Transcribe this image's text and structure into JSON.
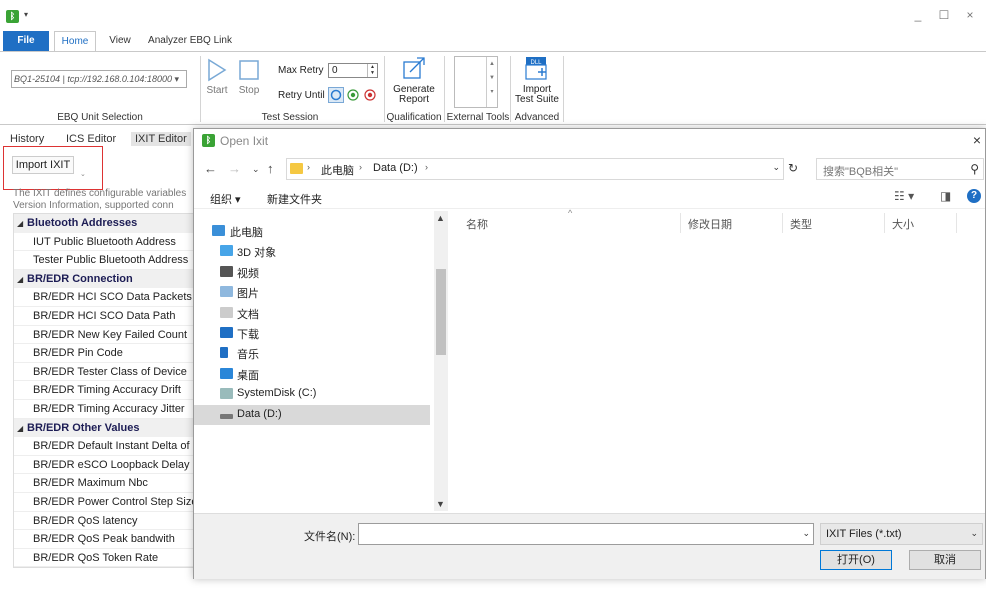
{
  "window": {
    "app_icon": "bluetooth-app-icon",
    "minimize": "_",
    "maximize": "☐",
    "close": "×"
  },
  "ribbon_tabs": [
    "File",
    "Home",
    "View",
    "Analyzer EBQ Link"
  ],
  "ribbon": {
    "ebq_combo_value": "BQ1-25104 | tcp://192.168.0.104:18000",
    "ebq_group_label": "EBQ Unit Selection",
    "start_label": "Start",
    "stop_label": "Stop",
    "max_retry_label": "Max Retry",
    "max_retry_value": "0",
    "retry_until_label": "Retry Until",
    "test_session_label": "Test Session",
    "generate_report_label_1": "Generate",
    "generate_report_label_2": "Report",
    "qualification_label": "Qualification",
    "external_tools_label": "External Tools",
    "import_test_suite_label_1": "Import",
    "import_test_suite_label_2": "Test Suite",
    "advanced_label": "Advanced"
  },
  "left": {
    "tabs": [
      "History",
      "ICS Editor",
      "IXIT Editor"
    ],
    "import_button": "Import IXIT",
    "description_1": "The IXIT defines configurable variables",
    "description_2": "Version Information, supported conn",
    "tree": [
      {
        "type": "header",
        "label": "Bluetooth Addresses"
      },
      {
        "type": "item",
        "label": "IUT Public Bluetooth Address"
      },
      {
        "type": "item",
        "label": "Tester Public Bluetooth Address"
      },
      {
        "type": "header",
        "label": "BR/EDR Connection"
      },
      {
        "type": "item",
        "label": "BR/EDR HCI SCO Data Packets Ne"
      },
      {
        "type": "item",
        "label": "BR/EDR HCI SCO Data Path"
      },
      {
        "type": "item",
        "label": "BR/EDR New Key Failed Count"
      },
      {
        "type": "item",
        "label": "BR/EDR Pin Code"
      },
      {
        "type": "item",
        "label": "BR/EDR Tester Class of Device"
      },
      {
        "type": "item",
        "label": "BR/EDR Timing Accuracy Drift"
      },
      {
        "type": "item",
        "label": "BR/EDR Timing Accuracy Jitter"
      },
      {
        "type": "header",
        "label": "BR/EDR Other Values"
      },
      {
        "type": "item",
        "label": "BR/EDR Default Instant Delta of P"
      },
      {
        "type": "item",
        "label": "BR/EDR eSCO Loopback Delay"
      },
      {
        "type": "item",
        "label": "BR/EDR Maximum Nbc"
      },
      {
        "type": "item",
        "label": "BR/EDR Power Control Step Size"
      },
      {
        "type": "item",
        "label": "BR/EDR QoS latency"
      },
      {
        "type": "item",
        "label": "BR/EDR QoS Peak bandwith"
      },
      {
        "type": "item",
        "label": "BR/EDR QoS Token Rate"
      }
    ]
  },
  "dialog": {
    "title": "Open Ixit",
    "address": {
      "root": "此电脑",
      "drive": "Data (D:)"
    },
    "search_placeholder": "搜索\"BQB相关\"",
    "organize": "组织 ▾",
    "new_folder": "新建文件夹",
    "nav_items": [
      {
        "label": "此电脑",
        "icon": "computer-icon"
      },
      {
        "label": "3D 对象",
        "icon": "3d-objects-icon"
      },
      {
        "label": "视频",
        "icon": "video-icon"
      },
      {
        "label": "图片",
        "icon": "pictures-icon"
      },
      {
        "label": "文档",
        "icon": "documents-icon"
      },
      {
        "label": "下载",
        "icon": "downloads-icon"
      },
      {
        "label": "音乐",
        "icon": "music-icon"
      },
      {
        "label": "桌面",
        "icon": "desktop-icon"
      },
      {
        "label": "SystemDisk (C:)",
        "icon": "system-drive-icon"
      },
      {
        "label": "Data (D:)",
        "icon": "drive-icon"
      }
    ],
    "columns": [
      "名称",
      "修改日期",
      "类型",
      "大小"
    ],
    "filename_label": "文件名(N):",
    "filename_value": "",
    "filter_value": "IXIT Files (*.txt)",
    "open_button": "打开(O)",
    "cancel_button": "取消"
  },
  "colors": {
    "accent": "#1f6fc4",
    "highlight": "#d33333",
    "selected": "#d9d9d9"
  }
}
